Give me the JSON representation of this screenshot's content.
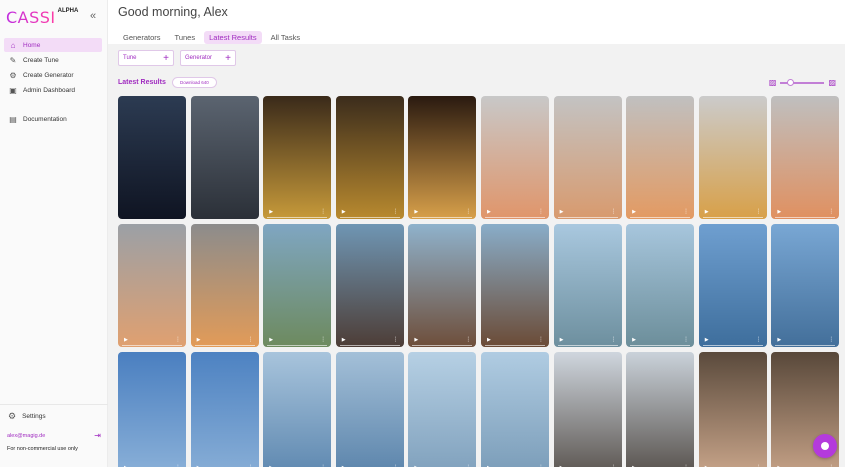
{
  "brand": {
    "name": "CASSI",
    "badge": "ALPHA"
  },
  "collapse_icon": "double-chevron-left-icon",
  "nav": [
    {
      "label": "Home",
      "icon": "home-icon",
      "active": true
    },
    {
      "label": "Create Tune",
      "icon": "tune-icon"
    },
    {
      "label": "Create Generator",
      "icon": "generator-icon"
    },
    {
      "label": "Admin Dashboard",
      "icon": "dashboard-icon"
    },
    {
      "label": "Documentation",
      "icon": "docs-icon"
    }
  ],
  "settings_label": "Settings",
  "user_email": "alex@magig.de",
  "license_note": "For non-commercial use only",
  "greeting": "Good morning, Alex",
  "tabs": [
    {
      "label": "Generators"
    },
    {
      "label": "Tunes"
    },
    {
      "label": "Latest Results",
      "active": true
    },
    {
      "label": "All Tasks"
    }
  ],
  "filters": {
    "tune": "Tune",
    "generator": "Generator"
  },
  "results": {
    "title": "Latest Results",
    "download_label": "Download 640"
  },
  "zoom": {
    "level": 0.15
  },
  "colors": {
    "accent": "#a02cc0",
    "accent_bg": "#f3dcf7",
    "fab": "#b43adc"
  },
  "thumbnails": [
    [
      "#2c3b52",
      "#0f1422"
    ],
    [
      "#5b6470",
      "#2b3038"
    ],
    [
      "#3a2a1a",
      "#c79a3a"
    ],
    [
      "#3b2c1c",
      "#b98a2f"
    ],
    [
      "#2a1a10",
      "#d8a04a"
    ],
    [
      "#c8c8c8",
      "#e0956a"
    ],
    [
      "#c3c3c3",
      "#d89a6e"
    ],
    [
      "#c0c0c0",
      "#e39a62"
    ],
    [
      "#cbcbcb",
      "#d8a048"
    ],
    [
      "#bfbfbf",
      "#e09060"
    ],
    [
      "#9ba0a6",
      "#e0a070"
    ],
    [
      "#8c8c8c",
      "#e29b58"
    ],
    [
      "#7fa6c2",
      "#6d8a5e"
    ],
    [
      "#6f96b4",
      "#4d3d36"
    ],
    [
      "#8fb2cc",
      "#6e4e3a"
    ],
    [
      "#89adc9",
      "#6b4b36"
    ],
    [
      "#a9c8df",
      "#6d8f9e"
    ],
    [
      "#a7c6dd",
      "#6c8e9a"
    ],
    [
      "#6f9fd0",
      "#3e6e9c"
    ],
    [
      "#79a7d4",
      "#436f9a"
    ],
    [
      "#4a7fc0",
      "#8ab0d8"
    ],
    [
      "#4d82c2",
      "#88aed6"
    ],
    [
      "#a8c4dc",
      "#5e88b0"
    ],
    [
      "#a4c0d8",
      "#5b84ab"
    ],
    [
      "#b6d0e4",
      "#7fa0bc"
    ],
    [
      "#b0cce2",
      "#7a9cb8"
    ],
    [
      "#cfd6de",
      "#5b5550"
    ],
    [
      "#cad2da",
      "#57514c"
    ],
    [
      "#5a4a3c",
      "#c9a58a"
    ],
    [
      "#58483a",
      "#c6a287"
    ]
  ],
  "fab_icon": "chat-bubble-icon"
}
